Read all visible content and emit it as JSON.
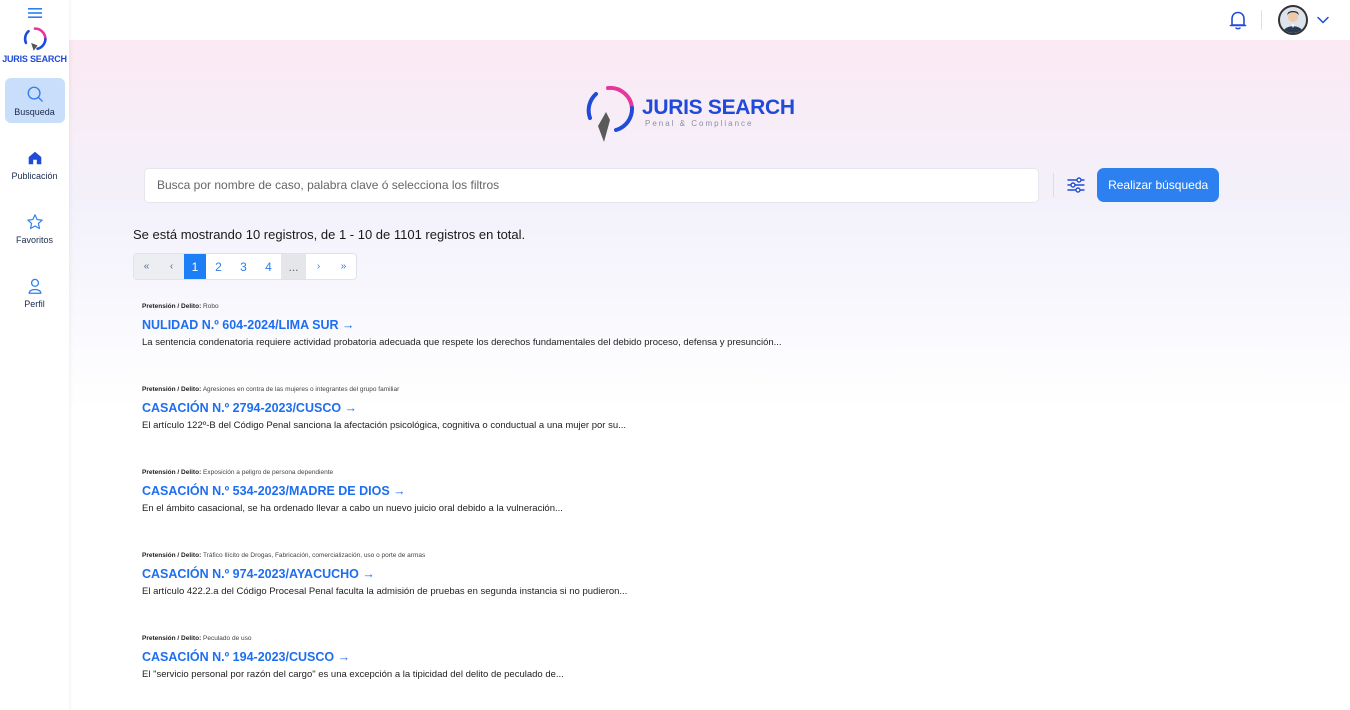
{
  "sidebar": {
    "logo_text": "JURIS SEARCH",
    "items": [
      {
        "label": "Busqueda",
        "icon": "search-icon",
        "active": true
      },
      {
        "label": "Publicación",
        "icon": "home-icon",
        "active": false
      },
      {
        "label": "Favoritos",
        "icon": "star-icon",
        "active": false
      },
      {
        "label": "Perfil",
        "icon": "user-icon",
        "active": false
      }
    ]
  },
  "header": {
    "icons": [
      "bell-icon",
      "avatar",
      "chevron-down-icon"
    ]
  },
  "hero": {
    "title": "JURIS SEARCH",
    "subtitle": "Penal & Compliance"
  },
  "search": {
    "placeholder": "Busca por nombre de caso, palabra clave ó selecciona los filtros",
    "value": "",
    "button_label": "Realizar búsqueda"
  },
  "summary": "Se está mostrando 10 registros, de 1 - 10 de 1101 registros en total.",
  "pagination": {
    "first": "«",
    "prev": "‹",
    "pages": [
      "1",
      "2",
      "3",
      "4"
    ],
    "ellipsis": "...",
    "next": "›",
    "last": "»",
    "current": "1"
  },
  "results": [
    {
      "meta_label": "Pretensión / Delito:",
      "meta_value": "Robo",
      "title": "NULIDAD N.º 604-2024/LIMA SUR",
      "description": "La sentencia condenatoria requiere actividad probatoria adecuada que respete los derechos fundamentales del debido proceso, defensa y presunción..."
    },
    {
      "meta_label": "Pretensión / Delito:",
      "meta_value": "Agresiones en contra de las mujeres o integrantes del grupo familiar",
      "title": "CASACIÓN N.º 2794-2023/CUSCO",
      "description": "El artículo 122º-B del Código Penal sanciona la afectación psicológica, cognitiva o conductual a una mujer por su..."
    },
    {
      "meta_label": "Pretensión / Delito:",
      "meta_value": "Exposición a peligro de persona dependiente",
      "title": "CASACIÓN N.º 534-2023/MADRE DE DIOS",
      "description": "En el ámbito casacional, se ha ordenado llevar a cabo un nuevo juicio oral debido a la vulneración..."
    },
    {
      "meta_label": "Pretensión / Delito:",
      "meta_value": "Tráfico Ilícito de Drogas, Fabricación, comercialización, uso o porte de armas",
      "title": "CASACIÓN N.º 974-2023/AYACUCHO",
      "description": "El artículo 422.2.a del Código Procesal Penal faculta la admisión de pruebas en segunda instancia si no pudieron..."
    },
    {
      "meta_label": "Pretensión / Delito:",
      "meta_value": "Peculado de uso",
      "title": "CASACIÓN N.º 194-2023/CUSCO",
      "description": "El \"servicio personal por razón del cargo\" es una excepción a la tipicidad del delito de peculado de..."
    }
  ],
  "colors": {
    "brand_blue": "#1f4bd8",
    "accent_blue": "#2d80f0",
    "link_blue": "#1e6ef0",
    "logo_pink": "#e8359a",
    "active_nav_bg": "#c9defa"
  }
}
